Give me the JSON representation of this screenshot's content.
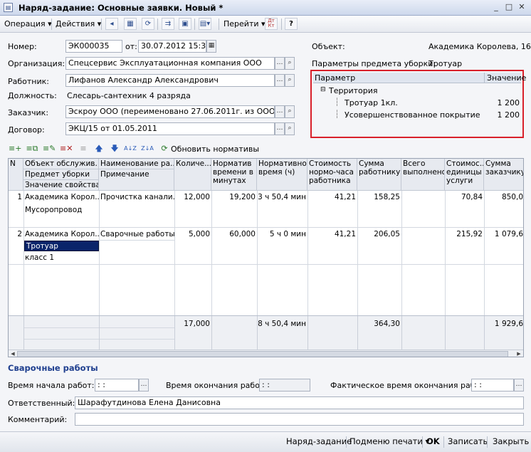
{
  "window": {
    "title": "Наряд-задание: Основные заявки. Новый *",
    "min": "_",
    "max": "□",
    "close": "✕"
  },
  "toolbar": {
    "operation": "Операция",
    "actions": "Действия",
    "goto": "Перейти",
    "help": "?"
  },
  "form": {
    "number_label": "Номер:",
    "number_value": "ЭК000035",
    "date_label": "от:",
    "date_value": "30.07.2012 15:34:0",
    "org_label": "Организация:",
    "org_value": "Спецсервис Эксплуатационная компания ООО",
    "worker_label": "Работник:",
    "worker_value": "Лифанов Александр Александрович",
    "position_label": "Должность:",
    "position_value": "Слесарь-сантехник 4 разряда",
    "customer_label": "Заказчик:",
    "customer_value": "Эскроу ООО (переименовано 27.06.2011г. из  ООО Инве",
    "contract_label": "Договор:",
    "contract_value": "ЭКЦ/15 от 01.05.2011",
    "object_label": "Объект:",
    "object_value": "Академика Королева, 16",
    "params_label": "Параметры предмета уборки:",
    "params_value": "Тротуар"
  },
  "param_table": {
    "col_param": "Параметр",
    "col_value": "Значение",
    "rows": [
      {
        "name": "Территория",
        "value": ""
      },
      {
        "name": "Тротуар 1кл.",
        "value": "1 200"
      },
      {
        "name": "Усовершенствованное покрытие",
        "value": "1 200"
      }
    ]
  },
  "grid_toolbar": {
    "update_label": "Обновить нормативы"
  },
  "grid": {
    "headers": {
      "n": "N",
      "object": "Объект обслужив...",
      "subject": "Предмет уборки",
      "prop_value": "Значение свойства",
      "work_name": "Наименование ра...",
      "note": "Примечание",
      "qty": "Количе...",
      "norm_min": "Норматив времени в минутах",
      "norm_hours": "Нормативное время (ч)",
      "cost_hour": "Стоимость нормо-часа работника",
      "sum_worker": "Сумма работнику",
      "done": "Всего выполнено",
      "cost_unit": "Стоимос... единицы услуги",
      "sum_customer": "Сумма заказчику"
    },
    "rows": [
      {
        "n": "1",
        "object": "Академика Корол...",
        "subject": "Мусоропровод",
        "prop_value": "",
        "work_name": "Прочистка канали...",
        "note": "",
        "qty": "12,000",
        "norm_min": "19,200",
        "norm_hours": "3 ч 50,4 мин",
        "cost_hour": "41,21",
        "sum_worker": "158,25",
        "done": "",
        "cost_unit": "70,84",
        "sum_customer": "850,0"
      },
      {
        "n": "2",
        "object": "Академика Корол...",
        "subject": "Тротуар",
        "prop_value": "класс 1",
        "work_name": "Сварочные работы",
        "note": "",
        "qty": "5,000",
        "norm_min": "60,000",
        "norm_hours": "5 ч 0 мин",
        "cost_hour": "41,21",
        "sum_worker": "206,05",
        "done": "",
        "cost_unit": "215,92",
        "sum_customer": "1 079,6"
      }
    ],
    "totals": {
      "qty": "17,000",
      "norm_hours": "8 ч 50,4 мин",
      "sum_worker": "364,30",
      "sum_customer": "1 929,6"
    }
  },
  "section": {
    "title": "Сварочные работы",
    "start_label": "Время начала работ:",
    "start_value": " :  :",
    "end_label": "Время окончания работ:",
    "end_value": " :  :",
    "actual_label": "Фактическое время окончания работ:",
    "actual_value": " :  :",
    "responsible_label": "Ответственный:",
    "responsible_value": "Шарафутдинова Елена Данисовна",
    "comment_label": "Комментарий:",
    "comment_value": ""
  },
  "bottom": {
    "work_order": "Наряд-задание",
    "print_menu": "Подменю печати",
    "ok": "OK",
    "save": "Записать",
    "close": "Закрыть"
  }
}
